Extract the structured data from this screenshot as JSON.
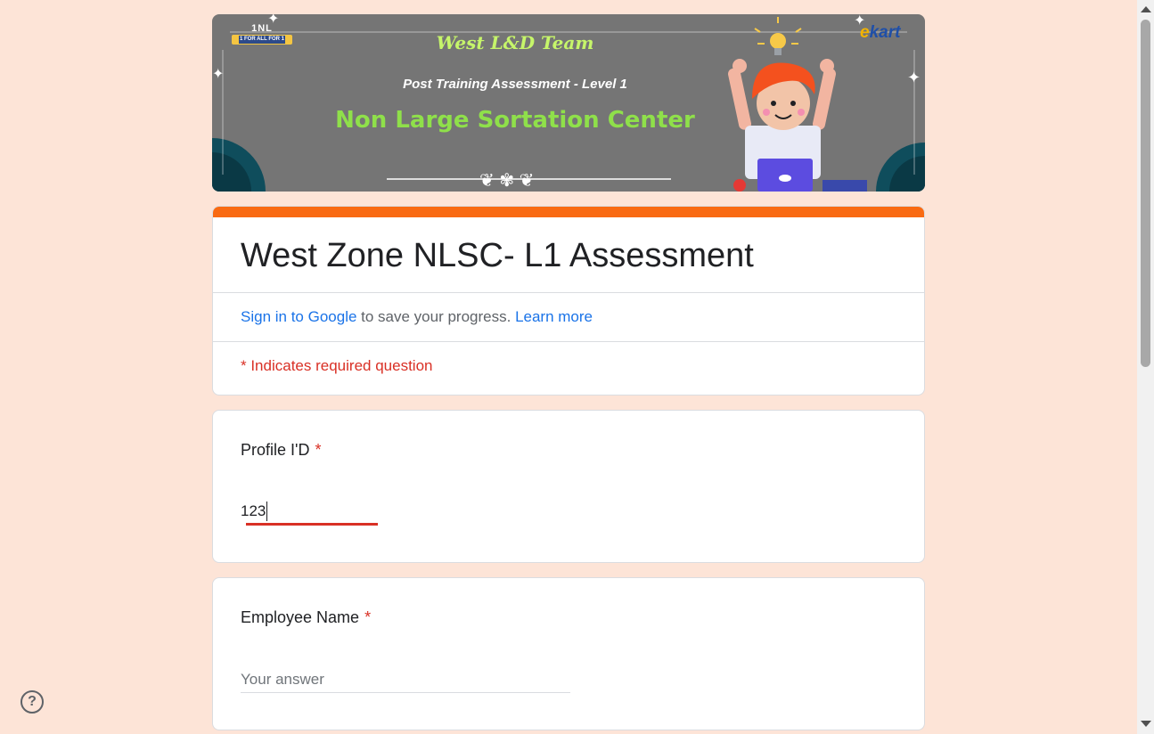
{
  "banner": {
    "team": "West L&D Team",
    "subtitle": "Post Training Assessment - Level 1",
    "center": "Non Large Sortation Center",
    "logo_left_big": "1NL",
    "logo_left_small": "1 FOR ALL FOR 1",
    "logo_right": "ekart"
  },
  "form": {
    "title": "West Zone NLSC- L1 Assessment",
    "signin_link": "Sign in to Google",
    "signin_text": " to save your progress. ",
    "learn_more": "Learn more",
    "required_note": "* Indicates required question"
  },
  "questions": [
    {
      "label": "Profile I'D",
      "required_mark": "*",
      "value": "123",
      "placeholder": ""
    },
    {
      "label": "Employee Name",
      "required_mark": "*",
      "value": "",
      "placeholder": "Your answer"
    }
  ],
  "help": {
    "glyph": "?"
  },
  "colors": {
    "accent": "#f96a12",
    "background": "#fde4d7",
    "error": "#d93025",
    "link": "#1a73e8"
  }
}
